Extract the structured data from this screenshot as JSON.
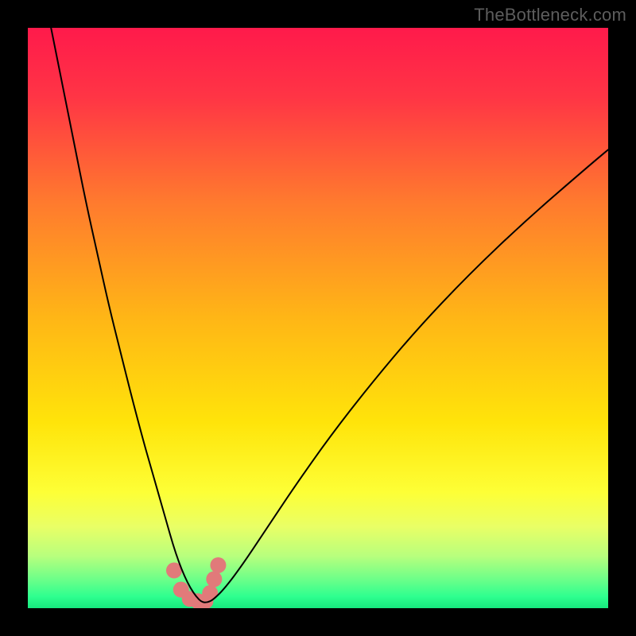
{
  "attribution": "TheBottleneck.com",
  "chart_data": {
    "type": "line",
    "title": "",
    "xlabel": "",
    "ylabel": "",
    "xlim": [
      0,
      100
    ],
    "ylim": [
      0,
      100
    ],
    "background": {
      "type": "vertical_gradient",
      "stops": [
        {
          "pct": 0,
          "color": "#ff1a4b"
        },
        {
          "pct": 12,
          "color": "#ff3545"
        },
        {
          "pct": 30,
          "color": "#ff7a2e"
        },
        {
          "pct": 50,
          "color": "#ffb616"
        },
        {
          "pct": 68,
          "color": "#ffe40a"
        },
        {
          "pct": 80,
          "color": "#fdff36"
        },
        {
          "pct": 86,
          "color": "#e9ff66"
        },
        {
          "pct": 91,
          "color": "#b8ff7d"
        },
        {
          "pct": 95,
          "color": "#6dff89"
        },
        {
          "pct": 98,
          "color": "#2eff8f"
        },
        {
          "pct": 100,
          "color": "#17e87e"
        }
      ]
    },
    "series": [
      {
        "name": "bottleneck_curve",
        "stroke": "#000000",
        "stroke_width": 2,
        "x": [
          4.0,
          6.0,
          8.0,
          10.0,
          12.0,
          14.0,
          16.0,
          18.0,
          20.0,
          21.0,
          22.0,
          23.0,
          24.0,
          25.0,
          26.0,
          27.0,
          28.0,
          29.0,
          30.0,
          31.0,
          32.0,
          34.0,
          37.0,
          41.0,
          46.0,
          52.0,
          59.0,
          67.0,
          76.0,
          86.0,
          97.0,
          100.0
        ],
        "y": [
          100.0,
          90.0,
          80.0,
          70.0,
          61.0,
          52.0,
          44.0,
          36.0,
          28.5,
          25.0,
          21.5,
          18.0,
          14.5,
          11.0,
          8.0,
          5.5,
          3.5,
          2.0,
          1.0,
          1.0,
          1.5,
          3.5,
          7.5,
          13.5,
          21.0,
          29.5,
          38.5,
          48.0,
          57.5,
          67.0,
          76.5,
          79.0
        ]
      },
      {
        "name": "marker_blobs",
        "type": "scatter",
        "fill": "#e17a7a",
        "radius": 10,
        "x": [
          25.2,
          26.4,
          27.9,
          29.3,
          30.6,
          31.4,
          32.1,
          32.8
        ],
        "y": [
          6.5,
          3.2,
          1.6,
          1.2,
          1.2,
          2.6,
          5.0,
          7.4
        ]
      }
    ]
  }
}
